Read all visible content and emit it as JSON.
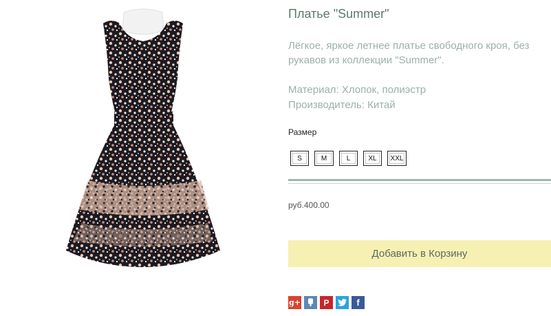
{
  "product": {
    "title": "Платье \"Summer\"",
    "description": "Лёгкое, яркое летнее платье свободного кроя, без рукавов из коллекции \"Summer\".",
    "material": "Материал: Хлопок, полиэстр",
    "manufacturer": "Производитель: Китай",
    "size_label": "Размер",
    "sizes": [
      "S",
      "M",
      "L",
      "XL",
      "XXL"
    ],
    "price": "руб.400.00",
    "add_to_cart_label": "Добавить в Корзину"
  },
  "colors": {
    "title": "#5c7a6a",
    "body_text": "#9cb0a8",
    "cart_button_bg": "#f7f0b3",
    "divider": "#9fb5ad",
    "google_plus": "#d7442f",
    "vk": "#5b88b8",
    "pinterest": "#c9252b",
    "twitter": "#2aa4de",
    "facebook": "#3a5a98"
  },
  "social": {
    "icons": [
      "google-plus-icon",
      "vk-icon",
      "pinterest-icon",
      "twitter-icon",
      "facebook-icon"
    ],
    "google_plus_text": "g+",
    "pinterest_text": "P",
    "facebook_text": "f"
  }
}
